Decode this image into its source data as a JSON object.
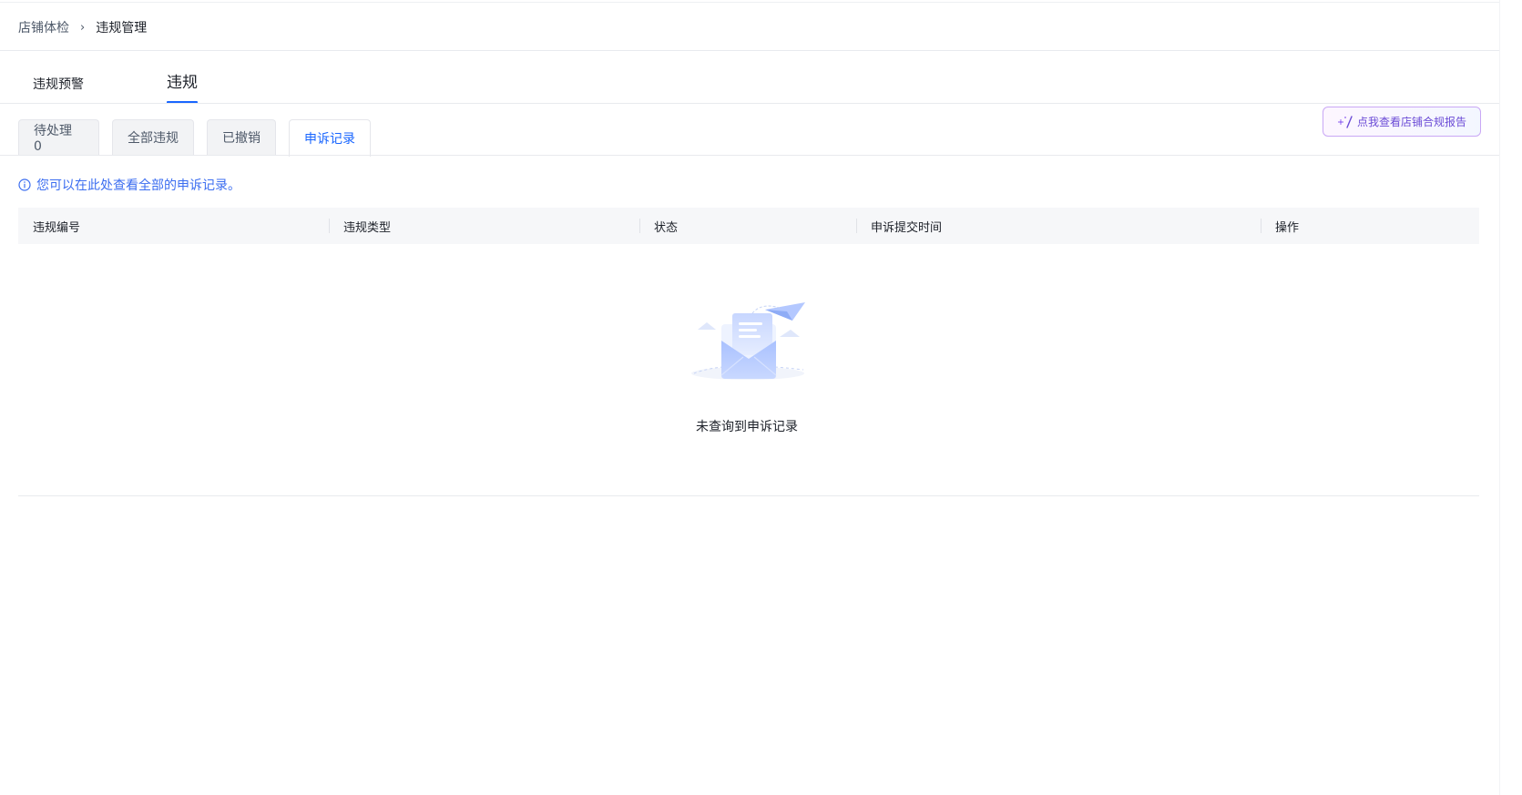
{
  "breadcrumb": {
    "parent": "店铺体检",
    "separator": "›",
    "current": "违规管理"
  },
  "main_tabs": [
    {
      "label": "违规预警"
    },
    {
      "label": "违规"
    }
  ],
  "sub_tabs": [
    {
      "label": "待处理 0"
    },
    {
      "label": "全部违规"
    },
    {
      "label": "已撤销"
    },
    {
      "label": "申诉记录"
    }
  ],
  "report_button": {
    "label": "点我查看店铺合规报告",
    "icon": "sparkle-icon"
  },
  "tip": {
    "text": "您可以在此处查看全部的申诉记录。",
    "icon": "info-icon"
  },
  "table": {
    "columns": [
      "违规编号",
      "违规类型",
      "状态",
      "申诉提交时间",
      "操作"
    ],
    "rows": []
  },
  "empty_state": {
    "text": "未查询到申诉记录",
    "icon": "empty-envelope-icon"
  },
  "colors": {
    "accent": "#1966ff",
    "report_border": "#c9a8f5",
    "report_text": "#6b4bd6",
    "header_bg": "#f6f7f9"
  }
}
